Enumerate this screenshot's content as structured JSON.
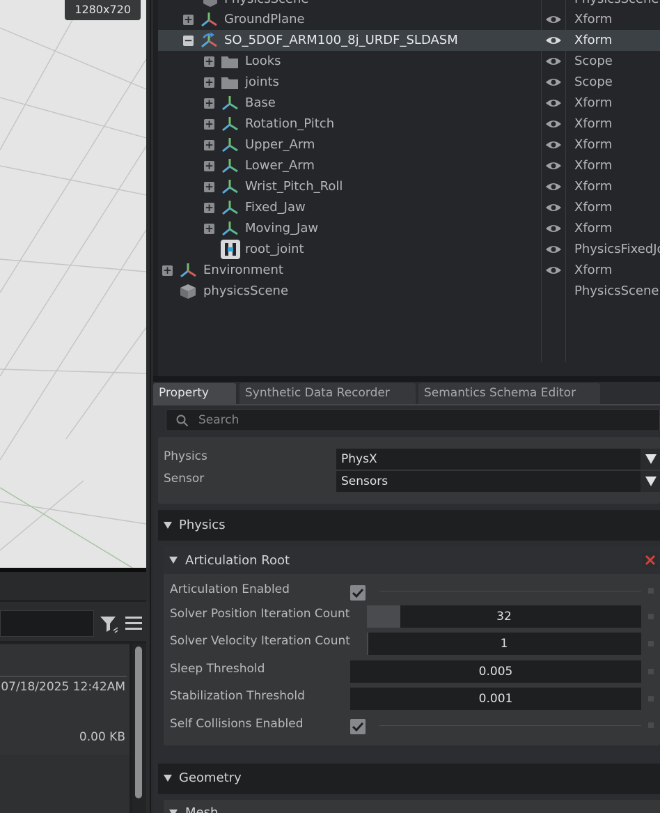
{
  "viewport": {
    "resolution": "1280x720"
  },
  "stage": {
    "rows": [
      {
        "name": "GroundPlane",
        "type": "Xform"
      },
      {
        "name": "SO_5DOF_ARM100_8j_URDF_SLDASM",
        "type": "Xform"
      },
      {
        "name": "Looks",
        "type": "Scope"
      },
      {
        "name": "joints",
        "type": "Scope"
      },
      {
        "name": "Base",
        "type": "Xform"
      },
      {
        "name": "Rotation_Pitch",
        "type": "Xform"
      },
      {
        "name": "Upper_Arm",
        "type": "Xform"
      },
      {
        "name": "Lower_Arm",
        "type": "Xform"
      },
      {
        "name": "Wrist_Pitch_Roll",
        "type": "Xform"
      },
      {
        "name": "Fixed_Jaw",
        "type": "Xform"
      },
      {
        "name": "Moving_Jaw",
        "type": "Xform"
      },
      {
        "name": "root_joint",
        "type": "PhysicsFixedJo"
      },
      {
        "name": "Environment",
        "type": "Xform"
      },
      {
        "name": "physicsScene",
        "type": "PhysicsScene"
      }
    ],
    "cut_top": {
      "name": "PhysicsScene",
      "type": "PhysicsScene"
    }
  },
  "content_browser": {
    "date": "07/18/2025 12:42AM",
    "size": "0.00 KB"
  },
  "tabs": [
    "Property",
    "Synthetic Data Recorder",
    "Semantics Schema Editor"
  ],
  "property": {
    "search_placeholder": "Search",
    "add": [
      {
        "label": "Physics",
        "value": "PhysX"
      },
      {
        "label": "Sensor",
        "value": "Sensors"
      }
    ],
    "physics_section": "Physics",
    "articulation_title": "Articulation Root",
    "fields": {
      "articulation_enabled": {
        "label": "Articulation Enabled",
        "checked": true
      },
      "pos_iter": {
        "label": "Solver Position Iteration Count",
        "value": "32"
      },
      "vel_iter": {
        "label": "Solver Velocity Iteration Count",
        "value": "1"
      },
      "sleep": {
        "label": "Sleep Threshold",
        "value": "0.005"
      },
      "stab": {
        "label": "Stabilization Threshold",
        "value": "0.001"
      },
      "self_coll": {
        "label": "Self Collisions Enabled",
        "checked": true
      }
    },
    "geometry_section": "Geometry",
    "mesh_section": "Mesh"
  }
}
